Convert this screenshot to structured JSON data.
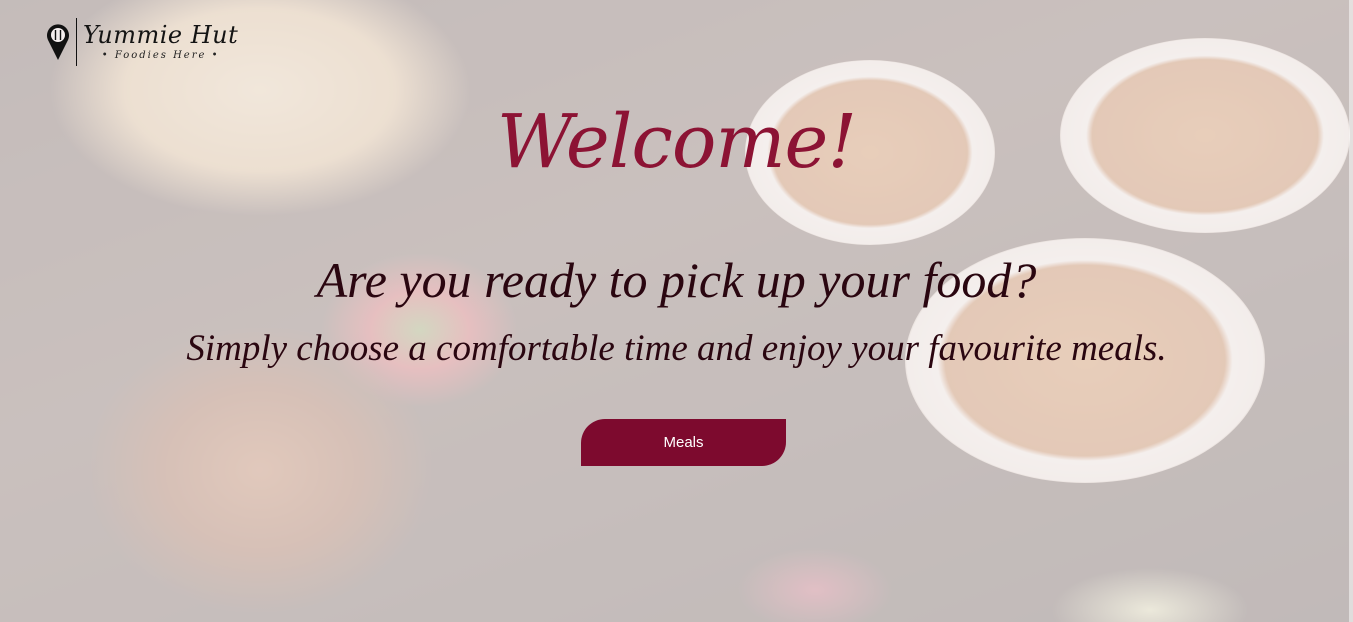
{
  "logo": {
    "icon": "map-pin-fork-knife-icon",
    "name": "Yummie Hut",
    "tagline": "• Foodies Here •"
  },
  "hero": {
    "welcome": "Welcome!",
    "headline": "Are you ready to pick up your food?",
    "subline": "Simply choose a comfortable time and enjoy your favourite meals.",
    "background": "food-photo-background"
  },
  "actions": {
    "meals_label": "Meals"
  },
  "colors": {
    "accent": "#8c1334",
    "button": "#7d0a2e",
    "text_dark": "#2a0610",
    "overlay": "#f4eeee"
  }
}
